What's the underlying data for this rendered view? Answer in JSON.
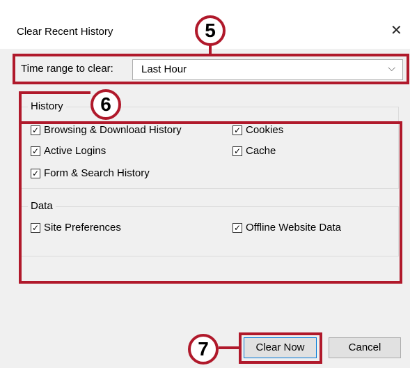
{
  "dialog": {
    "title": "Clear Recent History",
    "close_icon": "✕"
  },
  "time_range": {
    "label": "Time range to clear:",
    "value": "Last Hour",
    "chevron_icon": "⌵"
  },
  "history_group": {
    "legend": "History",
    "items": [
      {
        "label": "Browsing & Download History",
        "checked": true
      },
      {
        "label": "Cookies",
        "checked": true
      },
      {
        "label": "Active Logins",
        "checked": true
      },
      {
        "label": "Cache",
        "checked": true
      },
      {
        "label": "Form & Search History",
        "checked": true
      }
    ]
  },
  "data_group": {
    "legend": "Data",
    "items": [
      {
        "label": "Site Preferences",
        "checked": true
      },
      {
        "label": "Offline Website Data",
        "checked": true
      }
    ]
  },
  "buttons": {
    "clear_now": "Clear Now",
    "cancel": "Cancel"
  },
  "annotations": {
    "callout_5": "5",
    "callout_6": "6",
    "callout_7": "7",
    "color": "#b0192b"
  },
  "check_glyph": "✓"
}
